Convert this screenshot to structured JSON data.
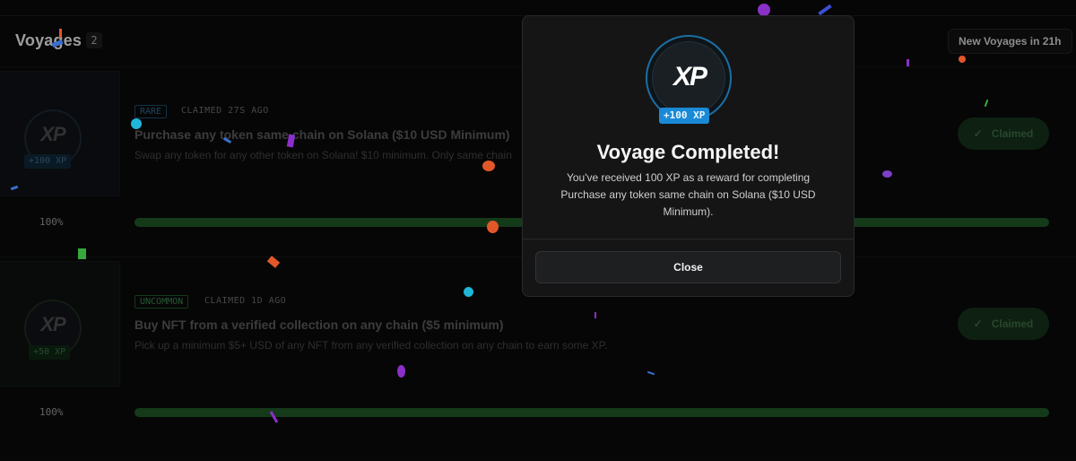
{
  "header": {
    "back_icon": "chevron-left-icon",
    "title": "Voyages",
    "count": "2",
    "new_voyages": "New Voyages in 21h"
  },
  "voyages": [
    {
      "xp_logo": "XP",
      "xp_reward": "+100 XP",
      "rarity": "RARE",
      "claimed_ago": "CLAIMED 27S AGO",
      "title": "Purchase any token same chain on Solana ($10 USD Minimum)",
      "description": "Swap any token for any other token on Solana! $10 minimum. Only same chain",
      "progress_label": "100%",
      "progress": 1.0,
      "status": "Claimed"
    },
    {
      "xp_logo": "XP",
      "xp_reward": "+50 XP",
      "rarity": "UNCOMMON",
      "claimed_ago": "CLAIMED 1D AGO",
      "title": "Buy NFT from a verified collection on any chain ($5 minimum)",
      "description": "Pick up a minimum $5+ USD of any NFT from any verified collection on any chain to earn some XP.",
      "progress_label": "100%",
      "progress": 1.0,
      "status": "Claimed"
    }
  ],
  "modal": {
    "xp_logo": "XP",
    "xp_reward": "+100 XP",
    "title": "Voyage Completed!",
    "body": "You've received 100 XP as a reward for completing Purchase any token same chain on Solana ($10 USD Minimum).",
    "close_label": "Close"
  },
  "colors": {
    "accent_blue": "#1a8ad6",
    "rare_blue": "#2f6a96",
    "uncommon_green": "#3e8a4f",
    "progress_green": "#1f5a28",
    "claimed_green": "#16321b"
  }
}
